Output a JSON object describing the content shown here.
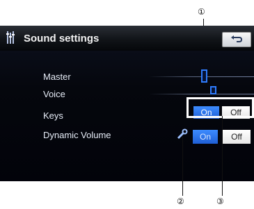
{
  "title": "Sound settings",
  "rows": {
    "master": {
      "label": "Master",
      "level": 0.57
    },
    "voice": {
      "label": "Voice",
      "level": 0.62
    },
    "keys": {
      "label": "Keys",
      "on": "On",
      "off": "Off",
      "selected": "On"
    },
    "dynamic_volume": {
      "label": "Dynamic Volume",
      "on": "On",
      "off": "Off",
      "selected": "On"
    }
  },
  "callouts": {
    "one": "①",
    "two": "②",
    "three": "③"
  },
  "colors": {
    "accent": "#2f7dff",
    "background": "#05070d"
  }
}
